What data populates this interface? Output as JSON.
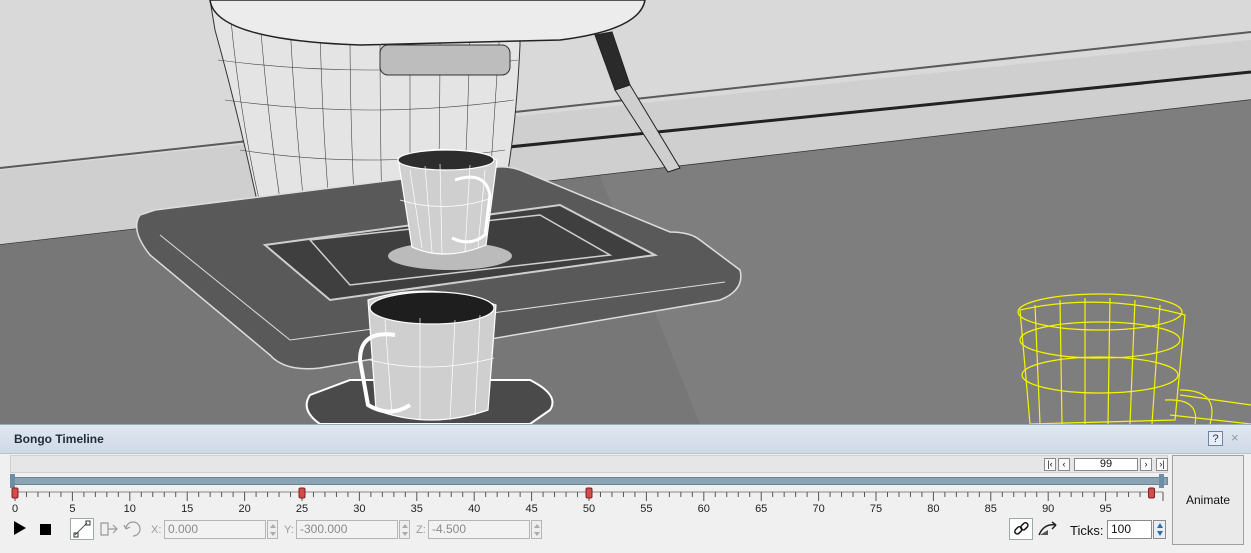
{
  "viewport": {
    "description_icon": "rendered-3d-scene",
    "wire_color": "#ffffff",
    "selected_wire_color": "#f5f500"
  },
  "timeline": {
    "title": "Bongo Timeline",
    "help_label": "?",
    "close_label": "×",
    "nav_first_label": "|‹",
    "nav_prev_label": "‹",
    "current_frame": "99",
    "nav_next_label": "›",
    "nav_last_label": "›|",
    "ruler_labels": [
      "0",
      "5",
      "10",
      "15",
      "20",
      "25",
      "30",
      "35",
      "40",
      "45",
      "50",
      "55",
      "60",
      "65",
      "70",
      "75",
      "80",
      "85",
      "90",
      "95"
    ],
    "ruler_max": 100,
    "keyframes": [
      0,
      25,
      50,
      99
    ],
    "keyframe_color": "#d44b4b",
    "animate_label": "Animate",
    "x_label": "X:",
    "x_value": "0.000",
    "y_label": "Y:",
    "y_value": "-300.000",
    "z_label": "Z:",
    "z_value": "-4.500",
    "ticks_label": "Ticks:",
    "ticks_value": "100"
  }
}
